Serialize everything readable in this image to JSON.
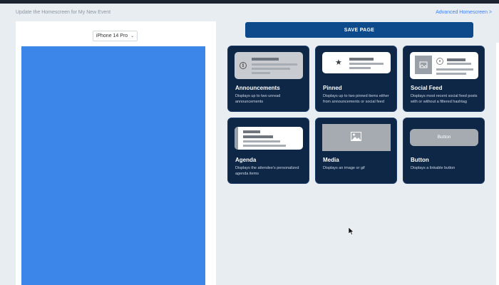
{
  "header": {
    "title": "Update the Homescreen for My New Event",
    "advanced_link": "Advanced Homescreen >"
  },
  "preview": {
    "device": "iPhone 14 Pro",
    "device_icon": "chevron-down-icon"
  },
  "toolbar": {
    "save_label": "SAVE PAGE"
  },
  "widgets": [
    {
      "id": "announcements",
      "title": "Announcements",
      "description": "Displays up to two unread announcements"
    },
    {
      "id": "pinned",
      "title": "Pinned",
      "description": "Displays up to two pinned items either from announcements or social feed"
    },
    {
      "id": "social-feed",
      "title": "Social Feed",
      "description": "Displays most recent social feed posts with or without a filtered hashtag"
    },
    {
      "id": "agenda",
      "title": "Agenda",
      "description": "Displays the attendee's personalized agenda items"
    },
    {
      "id": "media",
      "title": "Media",
      "description": "Displays an image or gif"
    },
    {
      "id": "button",
      "title": "Button",
      "description": "Displays a linkable button",
      "preview_label": "Button"
    }
  ],
  "colors": {
    "card_bg": "#0e2747",
    "save_button": "#0c4a8c",
    "phone_screen": "#3b86e8",
    "link": "#3b82f6"
  }
}
